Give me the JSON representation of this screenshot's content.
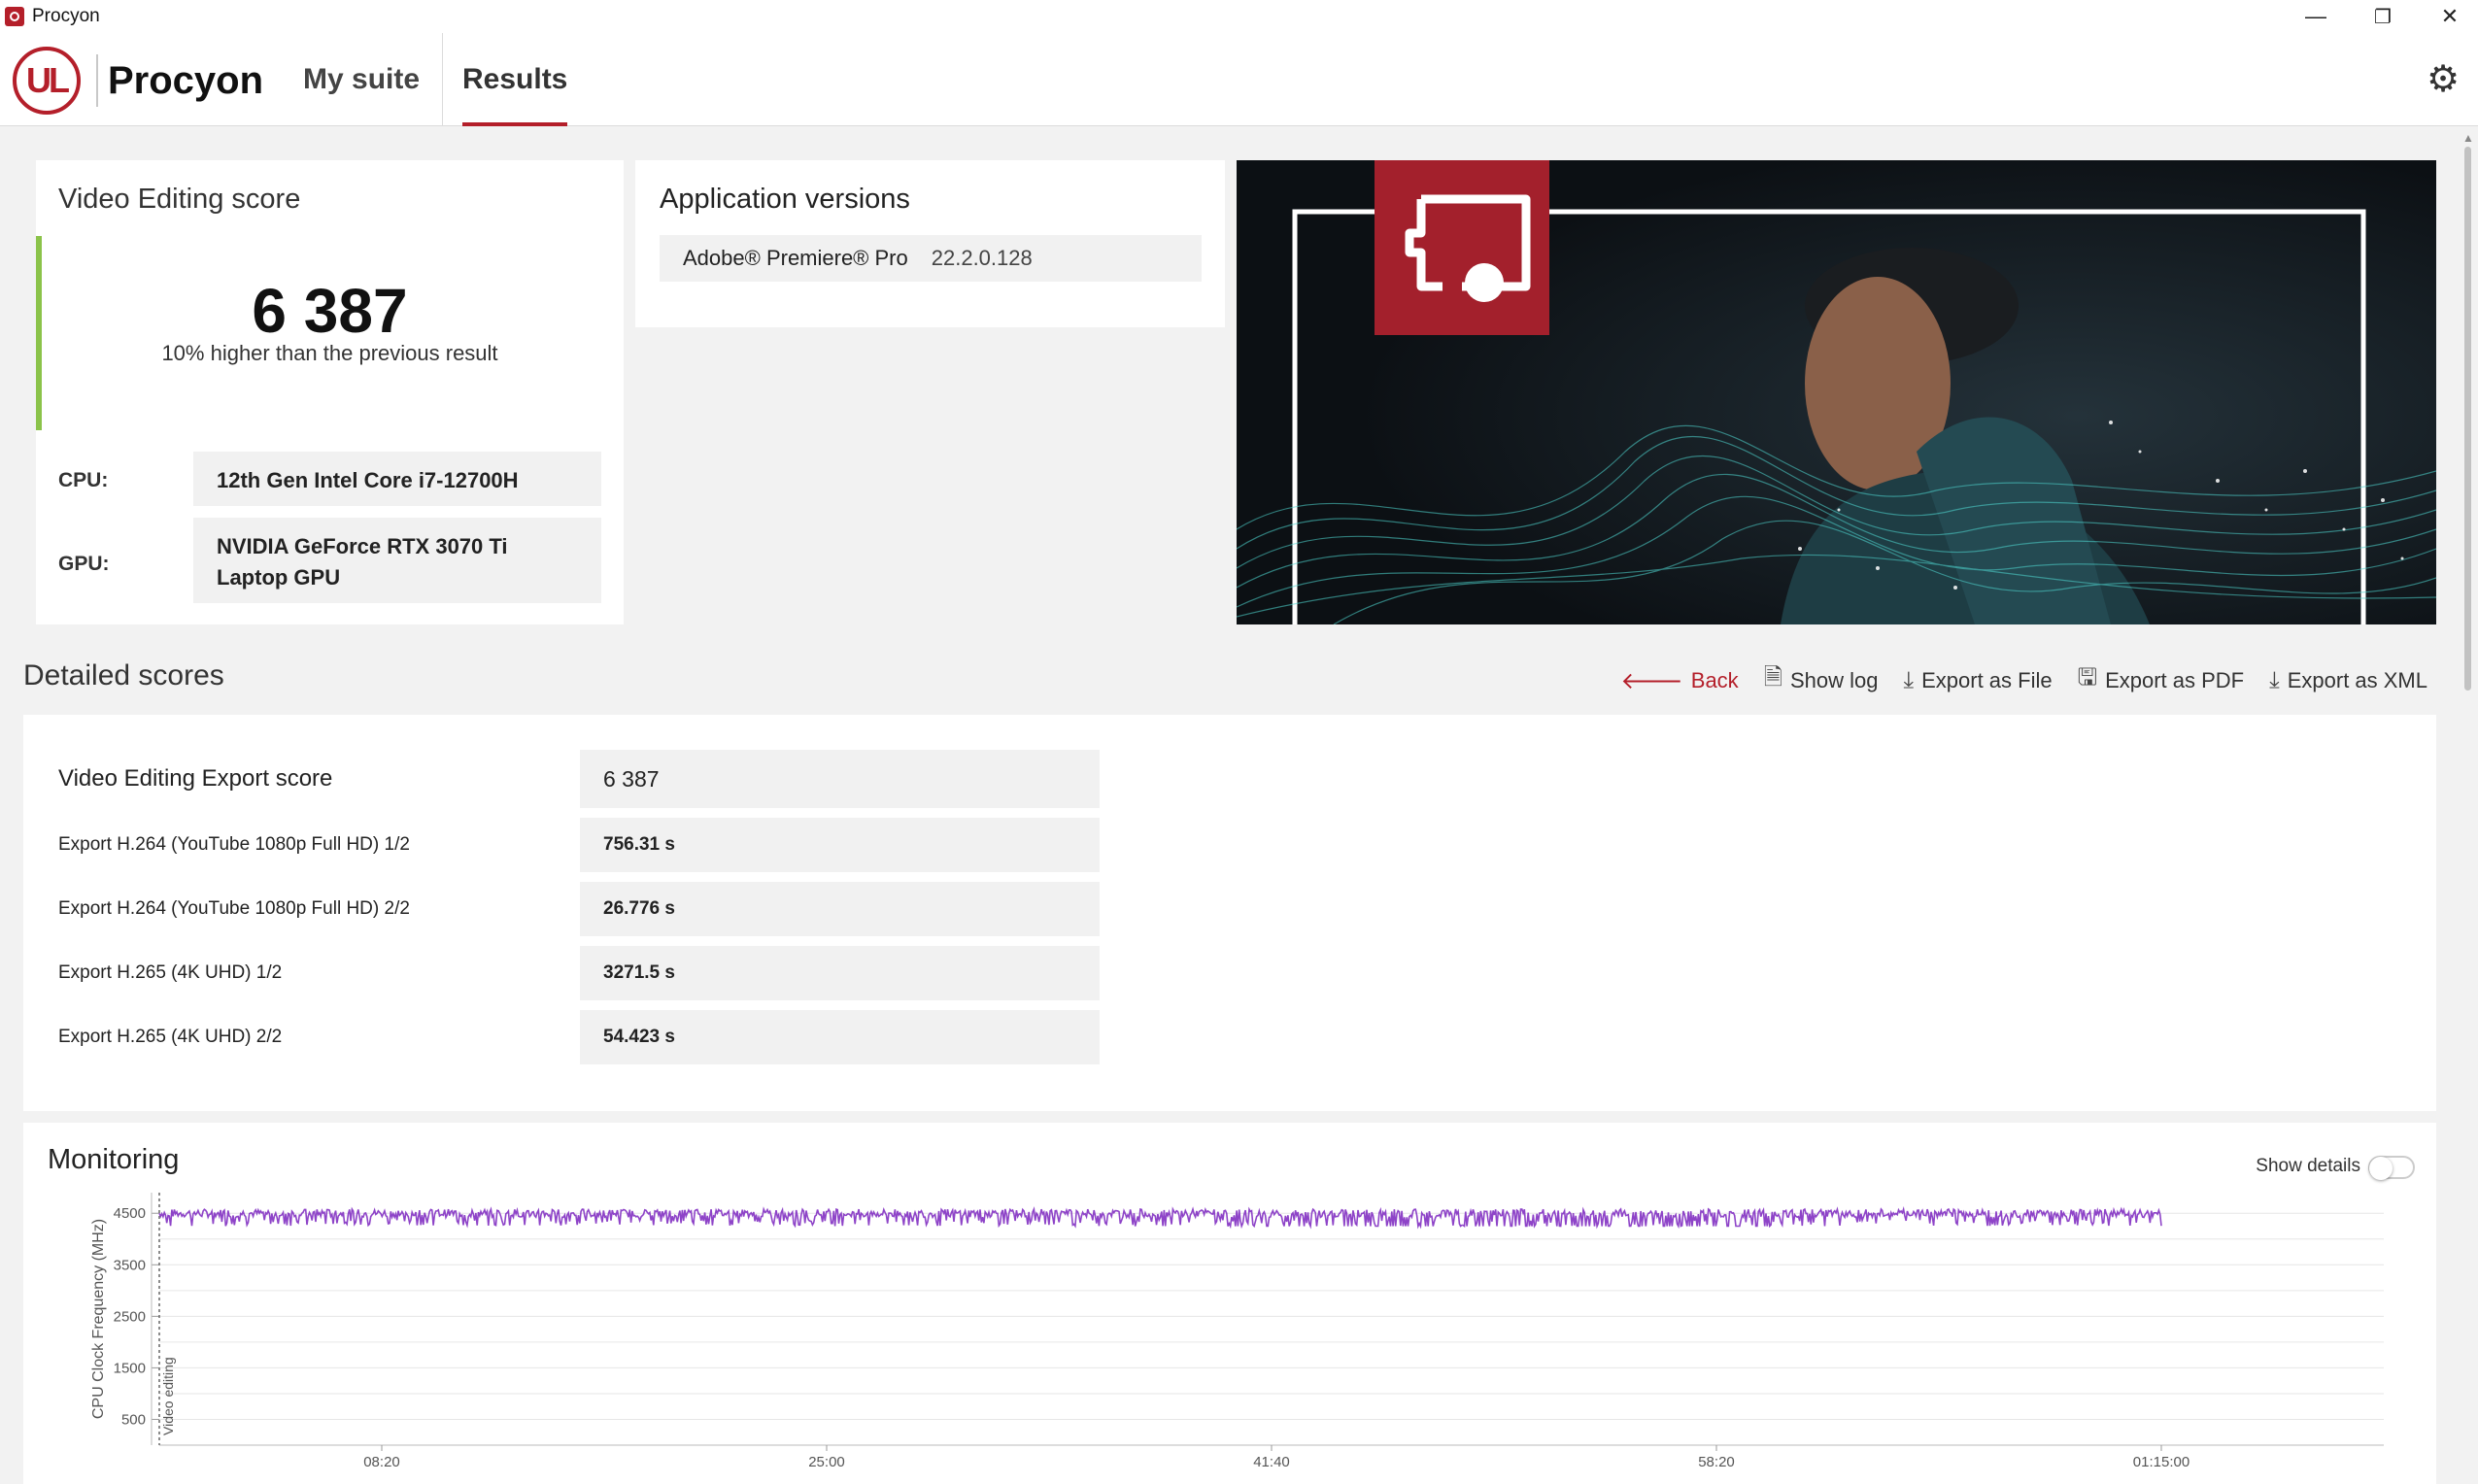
{
  "window": {
    "title": "Procyon",
    "minimize": "—",
    "restore": "❐",
    "close": "✕"
  },
  "header": {
    "logo_text": "UL",
    "brand": "Procyon",
    "tabs": [
      {
        "label": "My suite",
        "active": false
      },
      {
        "label": "Results",
        "active": true
      }
    ],
    "settings_icon": "gear-icon",
    "accent_color": "#b41f2a"
  },
  "score_card": {
    "title": "Video Editing score",
    "score": "6 387",
    "comparison": "10% higher than the previous result",
    "cpu_label": "CPU:",
    "cpu_value": "12th Gen Intel Core i7-12700H",
    "gpu_label": "GPU:",
    "gpu_value": "NVIDIA GeForce RTX 3070 Ti Laptop GPU",
    "accent_color": "#8bc34a"
  },
  "app_versions": {
    "title": "Application versions",
    "items": [
      {
        "name": "Adobe® Premiere® Pro",
        "version": "22.2.0.128"
      }
    ]
  },
  "detailed_scores": {
    "title": "Detailed scores",
    "actions": {
      "back": "Back",
      "show_log": "Show log",
      "export_file": "Export as File",
      "export_pdf": "Export as PDF",
      "export_xml": "Export as XML"
    },
    "rows": [
      {
        "label": "Video Editing Export score",
        "value": "6 387"
      },
      {
        "label": "Export H.264 (YouTube 1080p Full HD) 1/2",
        "value": "756.31 s"
      },
      {
        "label": "Export H.264 (YouTube 1080p Full HD) 2/2",
        "value": "26.776 s"
      },
      {
        "label": "Export H.265 (4K UHD) 1/2",
        "value": "3271.5 s"
      },
      {
        "label": "Export H.265 (4K UHD) 2/2",
        "value": "54.423 s"
      }
    ]
  },
  "monitoring": {
    "title": "Monitoring",
    "show_details_label": "Show details",
    "show_details_on": false
  },
  "chart_data": {
    "type": "line",
    "ylabel": "CPU Clock Frequency (MHz)",
    "ylim": [
      0,
      4900
    ],
    "y_ticks": [
      "500",
      "1500",
      "2500",
      "3500",
      "4500"
    ],
    "x_ticks": [
      "08:20",
      "25:00",
      "41:40",
      "58:20",
      "01:15:00"
    ],
    "x_tick_seconds": [
      500,
      1500,
      2500,
      3500,
      4500
    ],
    "xlim_seconds": [
      0,
      5000
    ],
    "series": [
      {
        "color": "#8e44c8",
        "x_seconds": [
          0,
          2400,
          3620,
          4500
        ],
        "values": [
          4500,
          4500,
          4500,
          4500
        ],
        "min_dips": 4250
      }
    ],
    "annotations": [
      {
        "label": "Video editing",
        "x_seconds": 0
      }
    ],
    "grid": true
  }
}
